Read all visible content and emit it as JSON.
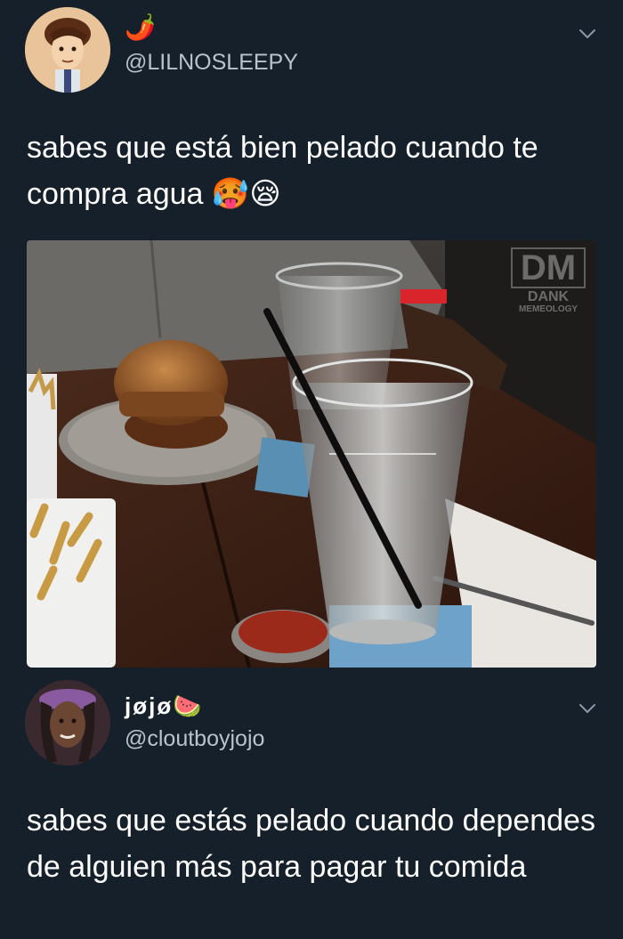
{
  "tweets": [
    {
      "display_name": "🌶️",
      "handle": "@LILNOSLEEPY",
      "text": "sabes que está bien pelado cuando te compra agua 🥵😪",
      "avatar_icon": "cartoon-boy-avatar",
      "media": {
        "watermark": {
          "logo": "DM",
          "line1": "DANK",
          "line2": "MEMEOLOGY"
        }
      }
    },
    {
      "display_name": "jøjø🍉",
      "handle": "@cloutboyjojo",
      "text": "sabes que estás pelado cuando dependes de alguien más para pagar tu comida",
      "avatar_icon": "user-photo-avatar"
    }
  ],
  "colors": {
    "background": "#15202b",
    "text": "#ffffff",
    "secondary_text": "#b8c3cc",
    "icon": "#8899a6"
  }
}
